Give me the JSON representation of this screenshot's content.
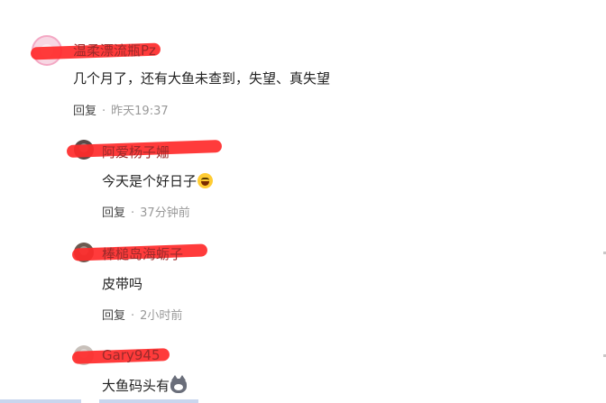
{
  "comments": [
    {
      "username": "温柔漂流瓶Pz",
      "content": "几个月了，还有大鱼未查到，失望、真失望",
      "reply_label": "回复",
      "time": "昨天19:37"
    },
    {
      "username": "阿爱杨子姗",
      "content": "今天是个好日子",
      "emoji": "grinning-squinting-face",
      "reply_label": "回复",
      "time": "37分钟前"
    },
    {
      "username": "棒槌岛海蛎子",
      "content": "皮带吗",
      "reply_label": "回复",
      "time": "2小时前"
    },
    {
      "username": "Gary945",
      "content": "大鱼码头有",
      "emoji": "cat-face",
      "reply_label": "回复",
      "time": ""
    }
  ],
  "separator": "·",
  "colors": {
    "redaction": "#ff2a2a",
    "username": "#9b2a2a",
    "meta": "#999999",
    "text": "#222222"
  }
}
